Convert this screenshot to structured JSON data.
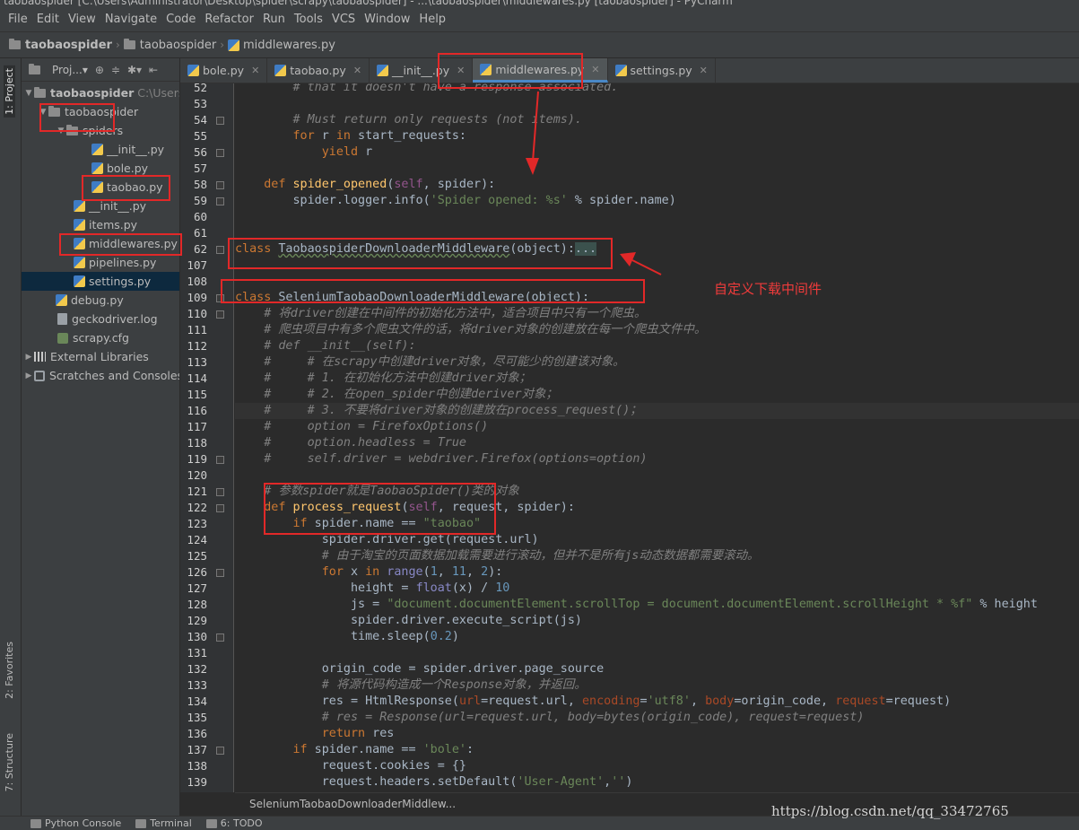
{
  "window": {
    "title": "taobaospider [C:\\Users\\Administrator\\Desktop\\spider\\scrapy\\taobaospider] - ...\\taobaospider\\middlewares.py [taobaospider] - PyCharm"
  },
  "menu": [
    "File",
    "Edit",
    "View",
    "Navigate",
    "Code",
    "Refactor",
    "Run",
    "Tools",
    "VCS",
    "Window",
    "Help"
  ],
  "breadcrumb": [
    "taobaospider",
    "taobaospider",
    "middlewares.py"
  ],
  "left_strip": {
    "project_tab": "1: Project",
    "favorites_tab": "2: Favorites",
    "structure_tab": "7: Structure"
  },
  "project_panel": {
    "header": "Proj...▾",
    "tree": {
      "root": "taobaospider",
      "root_path": "C:\\Users",
      "pkg": "taobaospider",
      "spiders": "spiders",
      "spiders_init": "__init__.py",
      "bole": "bole.py",
      "taobao": "taobao.py",
      "pkg_init": "__init__.py",
      "items": "items.py",
      "middlewares": "middlewares.py",
      "pipelines": "pipelines.py",
      "settings": "settings.py",
      "debug": "debug.py",
      "geckolog": "geckodriver.log",
      "scrapycfg": "scrapy.cfg",
      "extlibs": "External Libraries",
      "scratches": "Scratches and Consoles"
    }
  },
  "tabs": [
    "bole.py",
    "taobao.py",
    "__init__.py",
    "middlewares.py",
    "settings.py"
  ],
  "active_tab": "middlewares.py",
  "line_numbers": [
    "52",
    "53",
    "54",
    "55",
    "56",
    "57",
    "58",
    "59",
    "60",
    "61",
    "62",
    "107",
    "108",
    "109",
    "110",
    "111",
    "112",
    "113",
    "114",
    "115",
    "116",
    "117",
    "118",
    "119",
    "120",
    "121",
    "122",
    "123",
    "124",
    "125",
    "126",
    "127",
    "128",
    "129",
    "130",
    "131",
    "132",
    "133",
    "134",
    "135",
    "136",
    "137",
    "138",
    "139"
  ],
  "code": {
    "l52": "        # that it doesn't have a response associated.",
    "l54": "        # Must return only requests (not items).",
    "l55_for": "for",
    "l55_r": " r ",
    "l55_in": "in",
    "l55_rest": " start_requests:",
    "l56_yield": "yield",
    "l56_rest": " r",
    "l58_def": "def",
    "l58_fn": "spider_opened",
    "l58_self": "self",
    "l58_rest": ", spider):",
    "l59_a": "spider.logger.info(",
    "l59_str": "'Spider opened: %s'",
    "l59_b": " % spider.name)",
    "l62_class": "class",
    "l62_name": "TaobaospiderDownloaderMiddleware",
    "l62_rest": "(object):",
    "l62_fold": "...",
    "l109_class": "class",
    "l109_name": "SeleniumTaobaoDownloaderMiddleware",
    "l109_rest": "(object):",
    "l110": "    # 将driver创建在中间件的初始化方法中，适合项目中只有一个爬虫。",
    "l111": "    # 爬虫项目中有多个爬虫文件的话，将driver对象的创建放在每一个爬虫文件中。",
    "l112": "    # def __init__(self):",
    "l113": "    #     # 在scrapy中创建driver对象，尽可能少的创建该对象。",
    "l114": "    #     # 1. 在初始化方法中创建driver对象；",
    "l115": "    #     # 2. 在open_spider中创建deriver对象；",
    "l116": "    #     # 3. 不要将driver对象的创建放在process_request()；",
    "l117": "    #     option = FirefoxOptions()",
    "l118": "    #     option.headless = True",
    "l119": "    #     self.driver = webdriver.Firefox(options=option)",
    "l121": "    # 参数spider就是TaobaoSpider()类的对象",
    "l122_def": "def",
    "l122_fn": "process_request",
    "l122_self": "self",
    "l122_rest": ", request, spider):",
    "l123_if": "if",
    "l123_a": " spider.name == ",
    "l123_str": "\"taobao\"",
    "l124_a": "spider.driver.get(request.url)",
    "l125": "            # 由于淘宝的页面数据加载需要进行滚动，但并不是所有js动态数据都需要滚动。",
    "l126_for": "for",
    "l126_x": " x ",
    "l126_in": "in",
    "l126_range": " range",
    "l126_open": "(",
    "l126_n1": "1",
    "l126_c1": ", ",
    "l126_n2": "11",
    "l126_c2": ", ",
    "l126_n3": "2",
    "l126_close": "):",
    "l127_a": "height = ",
    "l127_float": "float",
    "l127_b": "(x) / ",
    "l127_n": "10",
    "l128_a": "js = ",
    "l128_str": "\"document.documentElement.scrollTop = document.documentElement.scrollHeight * %f\"",
    "l128_b": " % height",
    "l129_a": "spider.driver.execute_script(js)",
    "l130_a": "time.sleep(",
    "l130_n": "0.2",
    "l130_b": ")",
    "l132_a": "origin_code = spider.driver.page_source",
    "l133": "            # 将源代码构造成一个Response对象，并返回。",
    "l134_a": "res = HtmlResponse(",
    "l134_k1": "url",
    "l134_b": "=request.url, ",
    "l134_k2": "encoding",
    "l134_c": "=",
    "l134_str": "'utf8'",
    "l134_d": ", ",
    "l134_k3": "body",
    "l134_e": "=origin_code, ",
    "l134_k4": "request",
    "l134_f": "=request)",
    "l135": "            # res = Response(url=request.url, body=bytes(origin_code), request=request)",
    "l136_return": "return",
    "l136_rest": " res",
    "l137_if": "if",
    "l137_a": " spider.name == ",
    "l137_str": "'bole'",
    "l137_b": ":",
    "l138_a": "request.cookies = {}",
    "l139_a": "request.headers.setDefault(",
    "l139_str1": "'User-Agent'",
    "l139_b": ",",
    "l139_str2": "''",
    "l139_c": ")"
  },
  "editor_crumb": "SeleniumTaobaoDownloaderMiddlew...",
  "bottom_bar": [
    "Python Console",
    "Terminal",
    "6: TODO"
  ],
  "annotation": "自定义下载中间件",
  "watermark": "https://blog.csdn.net/qq_33472765",
  "colors": {
    "annotation_red": "#e22828",
    "active_tab_underline": "#4a88c7",
    "keyword": "#cc7832",
    "string": "#6a8759",
    "number": "#6897bb",
    "comment": "#808080"
  }
}
